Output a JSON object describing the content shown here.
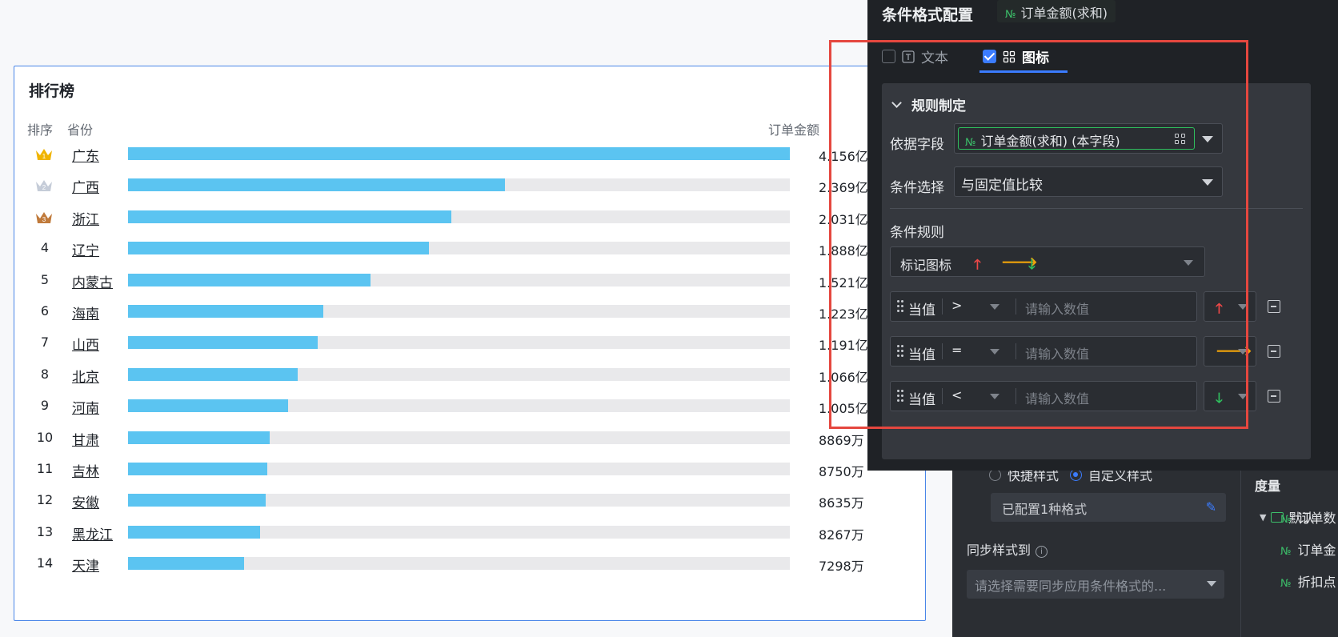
{
  "ranking": {
    "title": "排行榜",
    "headers": {
      "rank": "排序",
      "province": "省份",
      "amount": "订单金额"
    },
    "rows": [
      {
        "rank": "1",
        "province": "广东",
        "amount": "4.156亿",
        "ratio": 1.0,
        "crown": "gold-crown"
      },
      {
        "rank": "2",
        "province": "广西",
        "amount": "2.369亿",
        "ratio": 0.57,
        "crown": "silver-crown"
      },
      {
        "rank": "3",
        "province": "浙江",
        "amount": "2.031亿",
        "ratio": 0.489,
        "crown": "bronze-crown"
      },
      {
        "rank": "4",
        "province": "辽宁",
        "amount": "1.888亿",
        "ratio": 0.455
      },
      {
        "rank": "5",
        "province": "内蒙古",
        "amount": "1.521亿",
        "ratio": 0.366
      },
      {
        "rank": "6",
        "province": "海南",
        "amount": "1.223亿",
        "ratio": 0.295
      },
      {
        "rank": "7",
        "province": "山西",
        "amount": "1.191亿",
        "ratio": 0.287
      },
      {
        "rank": "8",
        "province": "北京",
        "amount": "1.066亿",
        "ratio": 0.256
      },
      {
        "rank": "9",
        "province": "河南",
        "amount": "1.005亿",
        "ratio": 0.242
      },
      {
        "rank": "10",
        "province": "甘肃",
        "amount": "8869万",
        "ratio": 0.214
      },
      {
        "rank": "11",
        "province": "吉林",
        "amount": "8750万",
        "ratio": 0.21
      },
      {
        "rank": "12",
        "province": "安徽",
        "amount": "8635万",
        "ratio": 0.208
      },
      {
        "rank": "13",
        "province": "黑龙江",
        "amount": "8267万",
        "ratio": 0.199
      },
      {
        "rank": "14",
        "province": "天津",
        "amount": "7298万",
        "ratio": 0.175
      }
    ]
  },
  "config": {
    "title": "条件格式配置",
    "field_chip": "订单金额(求和)",
    "num_tag": "№",
    "tabs": [
      {
        "label": "文本",
        "checked": false,
        "icon": "text-icon"
      },
      {
        "label": "图标",
        "checked": true,
        "icon": "grid-icon"
      }
    ],
    "rule_section": "规则制定",
    "basis_label": "依据字段",
    "basis_value": "订单金额(求和) (本字段)",
    "condition_label": "条件选择",
    "condition_value": "与固定值比较",
    "rules_label": "条件规则",
    "marker_label": "标记图标",
    "marker_icons": [
      "arrow-up-icon",
      "arrow-right-icon",
      "arrow-down-icon"
    ],
    "rules": [
      {
        "label": "当值",
        "op": ">",
        "placeholder": "请输入数值",
        "icon": "arrow-up-icon"
      },
      {
        "label": "当值",
        "op": "=",
        "placeholder": "请输入数值",
        "icon": "arrow-right-icon"
      },
      {
        "label": "当值",
        "op": "<",
        "placeholder": "请输入数值",
        "icon": "arrow-down-icon"
      }
    ],
    "colors": {
      "up": "#f04848",
      "right": "#f0a30a",
      "down": "#2fbf5e",
      "accent": "#3b7cff",
      "highlight": "#e5473f"
    }
  },
  "style_panel": {
    "quick_style": "快捷样式",
    "custom_style": "自定义样式",
    "configured": "已配置1种格式",
    "sync_label": "同步样式到",
    "sync_placeholder": "请选择需要同步应用条件格式的...",
    "measure_title": "度量",
    "folder": "默认",
    "measures": [
      "订单数",
      "订单金",
      "折扣点"
    ]
  }
}
